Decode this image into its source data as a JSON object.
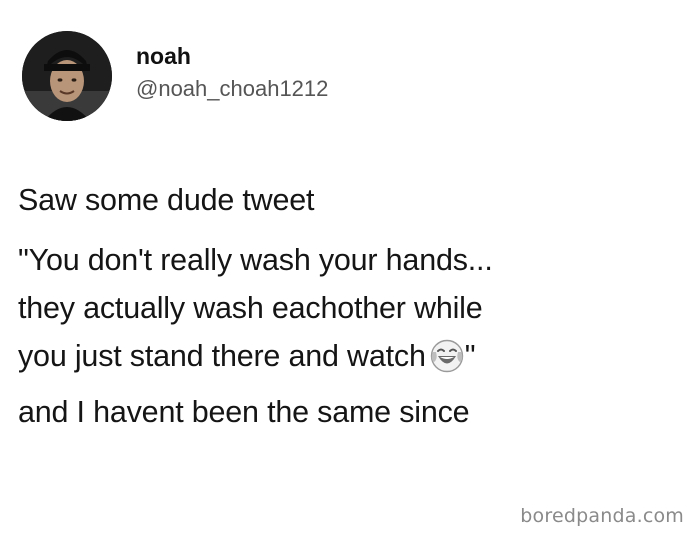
{
  "author": {
    "display_name": "noah",
    "handle": "@noah_choah1212"
  },
  "tweet": {
    "lines": [
      "Saw some dude tweet",
      "\"You don't really wash your hands...",
      "they actually wash eachother while",
      "you just stand there and watch",
      "\"",
      "and I havent been the same since"
    ],
    "emoji": "face-with-tears-of-joy-icon"
  },
  "watermark": "boredpanda.com"
}
